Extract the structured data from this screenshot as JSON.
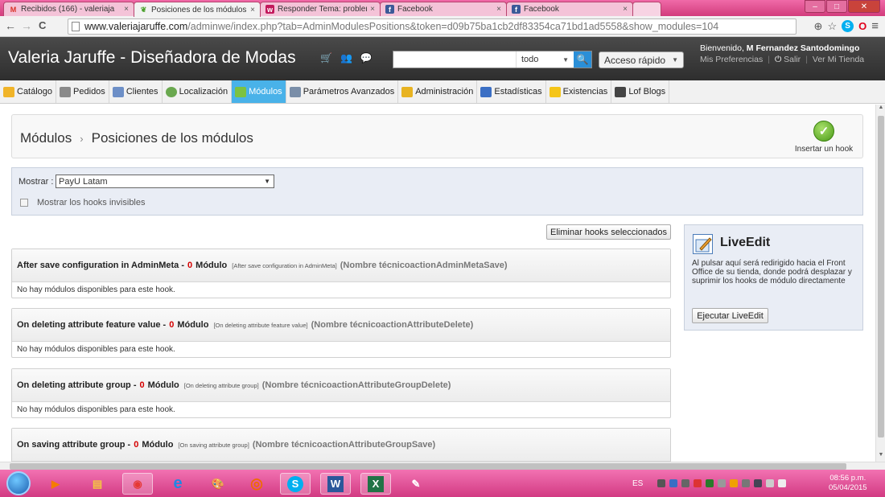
{
  "browser": {
    "tabs": [
      {
        "label": "Recibidos (166) - valeriaja",
        "icon": "gmail-icon",
        "icon_color": "#d93025",
        "icon_text": "M"
      },
      {
        "label": "Posiciones de los módulos",
        "icon": "prestashop-icon",
        "icon_color": "#4aa02c",
        "icon_text": "❦"
      },
      {
        "label": "Responder Tema: problem",
        "icon": "wordpress-icon",
        "icon_color": "#c2185b",
        "icon_text": "w"
      },
      {
        "label": "Facebook",
        "icon": "facebook-icon",
        "icon_color": "#3b5998",
        "icon_text": "f"
      },
      {
        "label": "Facebook",
        "icon": "facebook-icon",
        "icon_color": "#3b5998",
        "icon_text": "f"
      }
    ],
    "tab_close_glyph": "×",
    "back_glyph": "←",
    "forward_glyph": "→",
    "reload_glyph": "C",
    "url_host": "www.valeriajaruffe.com",
    "url_path": "/adminwe/index.php?tab=AdminModulesPositions&token=d09b75ba1cb2df83354ca71bd1ad5558&show_modules=104",
    "zoom_glyph": "⊕",
    "star_glyph": "☆",
    "skype_glyph": "S",
    "opera_glyph": "O",
    "menu_glyph": "≡"
  },
  "header": {
    "shop_name": "Valeria Jaruffe - Diseñadora de Modas",
    "cart_glyph": "🛒",
    "customers_glyph": "👥",
    "messages_glyph": "💬",
    "search_scope": "todo",
    "search_button_glyph": "🔍",
    "quick_access_label": "Acceso rápido",
    "welcome_prefix": "Bienvenido,",
    "welcome_user": "M Fernandez Santodomingo",
    "preferences_link": "Mis Preferencias",
    "logout_link": "Salir",
    "view_shop_link": "Ver Mi Tienda"
  },
  "menu": [
    {
      "label": "Catálogo",
      "color": "#f0b429"
    },
    {
      "label": "Pedidos",
      "color": "#8a8a8a"
    },
    {
      "label": "Clientes",
      "color": "#6d8fc7"
    },
    {
      "label": "Localización",
      "color": "#6aa84f"
    },
    {
      "label": "Módulos",
      "color": "#7cc242",
      "active": true
    },
    {
      "label": "Parámetros Avanzados",
      "color": "#7a8ea8"
    },
    {
      "label": "Administración",
      "color": "#e8b321"
    },
    {
      "label": "Estadísticas",
      "color": "#3b6fc4"
    },
    {
      "label": "Existencias",
      "color": "#f5c518"
    },
    {
      "label": "Lof Blogs",
      "color": "#444444"
    }
  ],
  "breadcrumb": {
    "parent": "Módulos",
    "separator": "›",
    "current": "Posiciones de los módulos"
  },
  "insert_hook": {
    "label": "Insertar un hook",
    "glyph": "✓"
  },
  "filter": {
    "show_label": "Mostrar :",
    "selected_module": "PayU Latam",
    "dropdown_glyph": "▼",
    "invisible_hooks_label": "Mostrar los hooks invisibles"
  },
  "delete_button": "Eliminar hooks seleccionados",
  "hooks": [
    {
      "title": "After save configuration in AdminMeta",
      "dash": "-",
      "count": "0",
      "modulo": "Módulo",
      "subtitle": "[After save configuration in AdminMeta]",
      "technical": "(Nombre técnicoactionAdminMetaSave)",
      "empty": "No hay módulos disponibles para este hook."
    },
    {
      "title": "On deleting attribute feature value",
      "dash": "-",
      "count": "0",
      "modulo": "Módulo",
      "subtitle": "[On deleting attribute feature value]",
      "technical": "(Nombre técnicoactionAttributeDelete)",
      "empty": "No hay módulos disponibles para este hook."
    },
    {
      "title": "On deleting attribute group",
      "dash": "-",
      "count": "0",
      "modulo": "Módulo",
      "subtitle": "[On deleting attribute group]",
      "technical": "(Nombre técnicoactionAttributeGroupDelete)",
      "empty": "No hay módulos disponibles para este hook."
    },
    {
      "title": "On saving attribute group",
      "dash": "-",
      "count": "0",
      "modulo": "Módulo",
      "subtitle": "[On saving attribute group]",
      "technical": "(Nombre técnicoactionAttributeGroupSave)",
      "empty": ""
    }
  ],
  "liveedit": {
    "title": "LiveEdit",
    "description": "Al pulsar aquí será redirigido hacia el Front Office de su tienda, donde podrá desplazar y suprimir los hooks de módulo directamente",
    "button": "Ejecutar LiveEdit"
  },
  "taskbar": {
    "apps": [
      {
        "name": "media-player-icon",
        "color": "#f57c00",
        "glyph": "▶"
      },
      {
        "name": "explorer-icon",
        "color": "#f4c542",
        "glyph": "▤"
      },
      {
        "name": "chrome-icon",
        "color": "#e53935",
        "glyph": "◉",
        "open": true
      },
      {
        "name": "internet-explorer-icon",
        "color": "#1e88e5",
        "glyph": "e"
      },
      {
        "name": "paint-icon",
        "color": "#ff9800",
        "glyph": "🎨"
      },
      {
        "name": "firefox-icon",
        "color": "#ef6c00",
        "glyph": "◎"
      },
      {
        "name": "skype-icon",
        "color": "#00aff0",
        "glyph": "S",
        "open": true
      },
      {
        "name": "word-icon",
        "color": "#2b579a",
        "glyph": "W",
        "open": true
      },
      {
        "name": "excel-icon",
        "color": "#217346",
        "glyph": "X",
        "open": true
      },
      {
        "name": "paint-net-icon",
        "color": "#8e7cc3",
        "glyph": "✎"
      }
    ],
    "language": "ES",
    "time": "08:56 p.m.",
    "date": "05/04/2015"
  }
}
